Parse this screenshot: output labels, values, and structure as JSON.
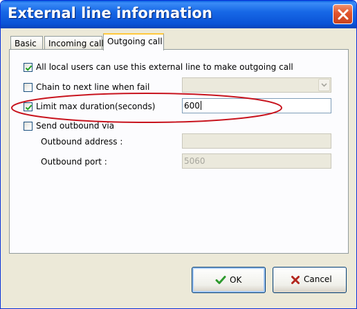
{
  "window": {
    "title": "External line information"
  },
  "tabs": [
    {
      "label": "Basic",
      "active": false
    },
    {
      "label": "Incoming call",
      "active": false
    },
    {
      "label": "Outgoing call",
      "active": true
    }
  ],
  "outgoing": {
    "all_local_users": {
      "label": "All local users can use this external line to make outgoing call",
      "checked": true
    },
    "chain_next_line": {
      "label": "Chain to next line when fail",
      "checked": false,
      "selected_value": ""
    },
    "limit_duration": {
      "label": "Limit max duration(seconds)",
      "checked": true,
      "value": "600"
    },
    "send_outbound": {
      "label": "Send outbound via",
      "checked": false
    },
    "outbound_address": {
      "label": "Outbound address :",
      "value": ""
    },
    "outbound_port": {
      "label": "Outbound port :",
      "value": "5060"
    }
  },
  "buttons": {
    "ok_label": "OK",
    "cancel_label": "Cancel"
  },
  "colors": {
    "titlebar": "#1768e6",
    "highlight_ellipse": "#c8141e",
    "ok_check": "#2e9a2e",
    "cancel_x": "#b3261e"
  }
}
